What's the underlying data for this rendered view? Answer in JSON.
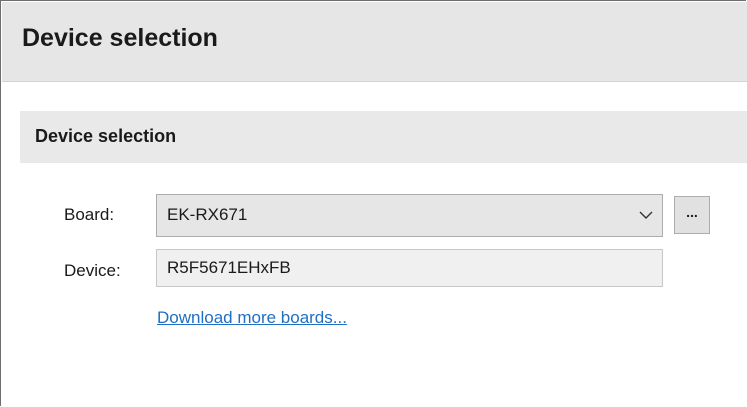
{
  "page": {
    "title": "Device selection"
  },
  "section": {
    "title": "Device selection"
  },
  "form": {
    "board_label": "Board:",
    "board_value": "EK-RX671",
    "board_browse_label": "...",
    "device_label": "Device:",
    "device_value": "R5F5671EHxFB",
    "download_link": "Download more boards..."
  },
  "icons": {
    "combo_arrow": "chevron-down-icon"
  },
  "colors": {
    "header_bg": "#e6e6e6",
    "link": "#1f6fc5"
  }
}
